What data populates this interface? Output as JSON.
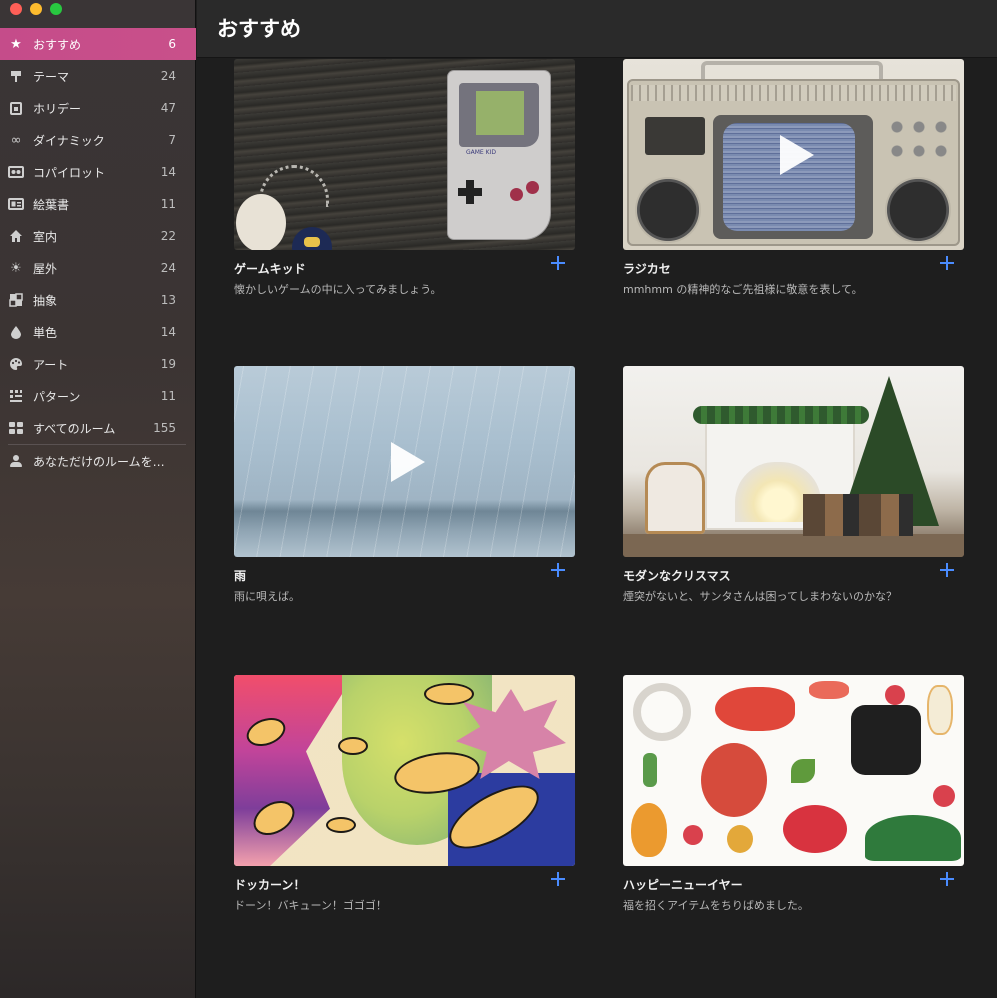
{
  "window": {
    "traffic_lights": [
      "close",
      "minimize",
      "maximize"
    ]
  },
  "sidebar": {
    "items": [
      {
        "label": "おすすめ",
        "count": "6",
        "icon": "star-icon"
      },
      {
        "label": "テーマ",
        "count": "24",
        "icon": "signpost-icon"
      },
      {
        "label": "ホリデー",
        "count": "47",
        "icon": "calendar-icon"
      },
      {
        "label": "ダイナミック",
        "count": "7",
        "icon": "infinity-icon"
      },
      {
        "label": "コパイロット",
        "count": "14",
        "icon": "people-icon"
      },
      {
        "label": "絵葉書",
        "count": "11",
        "icon": "postcard-icon"
      },
      {
        "label": "室内",
        "count": "22",
        "icon": "house-icon"
      },
      {
        "label": "屋外",
        "count": "24",
        "icon": "sun-icon"
      },
      {
        "label": "抽象",
        "count": "13",
        "icon": "abstract-icon"
      },
      {
        "label": "単色",
        "count": "14",
        "icon": "drop-icon"
      },
      {
        "label": "アート",
        "count": "19",
        "icon": "palette-icon"
      },
      {
        "label": "パターン",
        "count": "11",
        "icon": "pattern-icon"
      },
      {
        "label": "すべてのルーム",
        "count": "155",
        "icon": "grid-icon"
      }
    ],
    "footer_item": {
      "label": "あなただけのルームを…",
      "icon": "person-icon"
    }
  },
  "header": {
    "title": "おすすめ"
  },
  "cards": [
    {
      "title": "ゲームキッド",
      "desc": "懐かしいゲームの中に入ってみましょう。",
      "has_play": false
    },
    {
      "title": "ラジカセ",
      "desc": "mmhmm の精神的なご先祖様に敬意を表して。",
      "has_play": true
    },
    {
      "title": "雨",
      "desc": "雨に唄えば。",
      "has_play": true
    },
    {
      "title": "モダンなクリスマス",
      "desc": "煙突がないと、サンタさんは困ってしまわないのかな？",
      "has_play": false
    },
    {
      "title": "ドッカーン！",
      "desc": "ドーン！バキューン！ゴゴゴ！",
      "has_play": false
    },
    {
      "title": "ハッピーニューイヤー",
      "desc": "福を招くアイテムをちりばめました。",
      "has_play": false
    }
  ],
  "gamekid_brand": "GAME KID",
  "colors": {
    "accent_active": "#c9508a",
    "add_button": "#4a8cff"
  }
}
